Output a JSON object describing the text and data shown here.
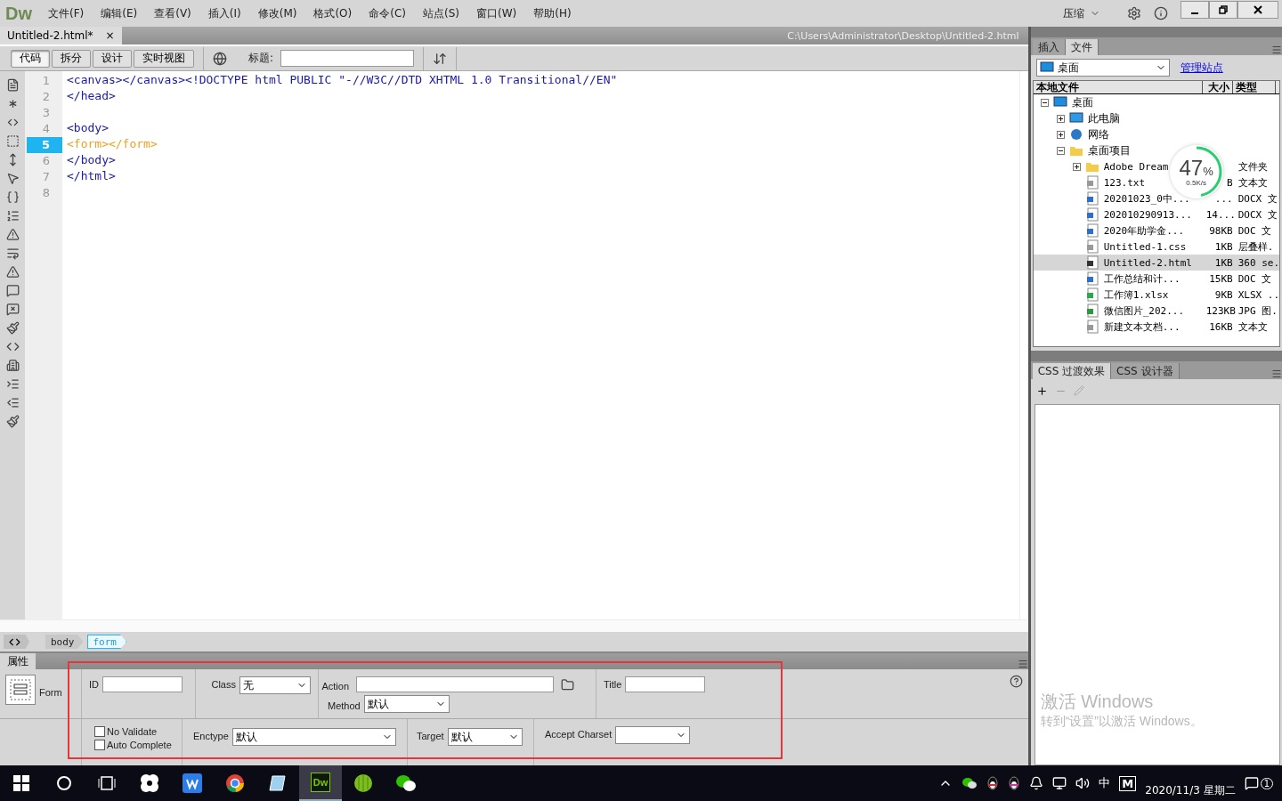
{
  "app": {
    "logo": "Dw",
    "menu": [
      "文件(F)",
      "编辑(E)",
      "查看(V)",
      "插入(I)",
      "修改(M)",
      "格式(O)",
      "命令(C)",
      "站点(S)",
      "窗口(W)",
      "帮助(H)"
    ],
    "workspace": "压缩"
  },
  "document_tab": {
    "title": "Untitled-2.html*",
    "close": "×",
    "path": "C:\\Users\\Administrator\\Desktop\\Untitled-2.html"
  },
  "toolbar": {
    "views": [
      {
        "label": "代码",
        "selected": true
      },
      {
        "label": "拆分",
        "selected": false
      },
      {
        "label": "设计",
        "selected": false
      },
      {
        "label": "实时视图",
        "selected": false
      }
    ],
    "title_label": "标题:"
  },
  "code": {
    "lines": [
      {
        "number": "1",
        "text": "<canvas></canvas><!DOCTYPE html PUBLIC \"-//W3C//DTD XHTML 1.0 Transitional//EN\"",
        "kind": "tag",
        "current": false
      },
      {
        "number": "2",
        "text": "</head>",
        "kind": "tag",
        "current": false
      },
      {
        "number": "3",
        "kind": "blank",
        "current": false
      },
      {
        "number": "4",
        "text": "<body>",
        "kind": "tag",
        "current": false
      },
      {
        "number": "5",
        "text": "<form></form>",
        "kind": "highlight",
        "current": true
      },
      {
        "number": "6",
        "text": "</body>",
        "kind": "tag",
        "current": false
      },
      {
        "number": "7",
        "text": "</html>",
        "kind": "tag",
        "current": false
      },
      {
        "number": "8",
        "kind": "blank",
        "current": false
      }
    ]
  },
  "tag_selector": [
    {
      "label": "body",
      "selected": false
    },
    {
      "label": "form",
      "selected": true
    }
  ],
  "properties": {
    "tab": "属性",
    "element": "Form",
    "id_label": "ID",
    "class_label": "Class",
    "class_value": "无",
    "action_label": "Action",
    "method_label": "Method",
    "method_value": "默认",
    "title_label": "Title",
    "checkboxes": [
      {
        "label": "No Validate",
        "checked": false
      },
      {
        "label": "Auto Complete",
        "checked": false
      }
    ],
    "enctype_label": "Enctype",
    "enctype_value": "默认",
    "target_label": "Target",
    "target_value": "默认",
    "charset_label": "Accept Charset"
  },
  "files_panel": {
    "tabs": [
      {
        "label": "插入",
        "selected": false
      },
      {
        "label": "文件",
        "selected": true
      }
    ],
    "site": "桌面",
    "manage_link": "管理站点",
    "columns": [
      "本地文件",
      "大小",
      "类型"
    ],
    "tree": [
      {
        "name": "桌面",
        "kind": "desktop",
        "expanded": true,
        "selected": false,
        "children": [
          {
            "name": "此电脑",
            "kind": "computer",
            "expanded": false,
            "selected": false
          },
          {
            "name": "网络",
            "kind": "network",
            "expanded": false,
            "selected": false
          },
          {
            "name": "桌面项目",
            "kind": "folder",
            "expanded": true,
            "selected": false,
            "children": [
              {
                "name": "Adobe Dream",
                "kind": "folder",
                "expanded": false,
                "type": "文件夹",
                "selected": false
              },
              {
                "name": "123.txt",
                "kind": "text",
                "size": "B",
                "type": "文本文",
                "selected": false
              },
              {
                "name": "20201023_0中...",
                "kind": "word",
                "size": "...",
                "type": "DOCX 文",
                "selected": false
              },
              {
                "name": "202010290913...",
                "kind": "word",
                "size": "14...",
                "type": "DOCX 文",
                "selected": false
              },
              {
                "name": "2020年助学金...",
                "kind": "word",
                "size": "98KB",
                "type": "DOC 文",
                "selected": false
              },
              {
                "name": "Untitled-1.css",
                "kind": "css",
                "size": "1KB",
                "type": "层叠样.",
                "selected": false
              },
              {
                "name": "Untitled-2.html",
                "kind": "html",
                "size": "1KB",
                "type": "360 se.",
                "selected": true
              },
              {
                "name": "工作总结和计...",
                "kind": "word",
                "size": "15KB",
                "type": "DOC 文",
                "selected": false
              },
              {
                "name": "工作簿1.xlsx",
                "kind": "excel",
                "size": "9KB",
                "type": "XLSX ..",
                "selected": false
              },
              {
                "name": "微信图片_202...",
                "kind": "image",
                "size": "123KB",
                "type": "JPG 图.",
                "selected": false
              },
              {
                "name": "新建文本文档...",
                "kind": "text",
                "size": "16KB",
                "type": "文本文",
                "selected": false
              }
            ]
          }
        ]
      }
    ]
  },
  "download_widget": {
    "percent": "47",
    "unit": "%",
    "speed": "0.5K/s",
    "level": 0.47
  },
  "css_panel": {
    "tabs": [
      {
        "label": "CSS 过渡效果",
        "selected": true
      },
      {
        "label": "CSS 设计器",
        "selected": false
      }
    ]
  },
  "activation": {
    "title": "激活 Windows",
    "text": "转到“设置”以激活 Windows。"
  },
  "taskbar": {
    "apps": [
      {
        "kind": "pinwheel",
        "selected": false
      },
      {
        "kind": "wps",
        "selected": false
      },
      {
        "kind": "chrome",
        "selected": false
      },
      {
        "kind": "notes",
        "selected": false
      },
      {
        "kind": "dw",
        "label": "Dw",
        "selected": true
      },
      {
        "kind": "ball",
        "selected": false
      },
      {
        "kind": "wechat",
        "selected": false
      }
    ],
    "ime": "中",
    "ime_mode": "M",
    "date": "2020/11/3 星期二",
    "notifications": "1"
  }
}
